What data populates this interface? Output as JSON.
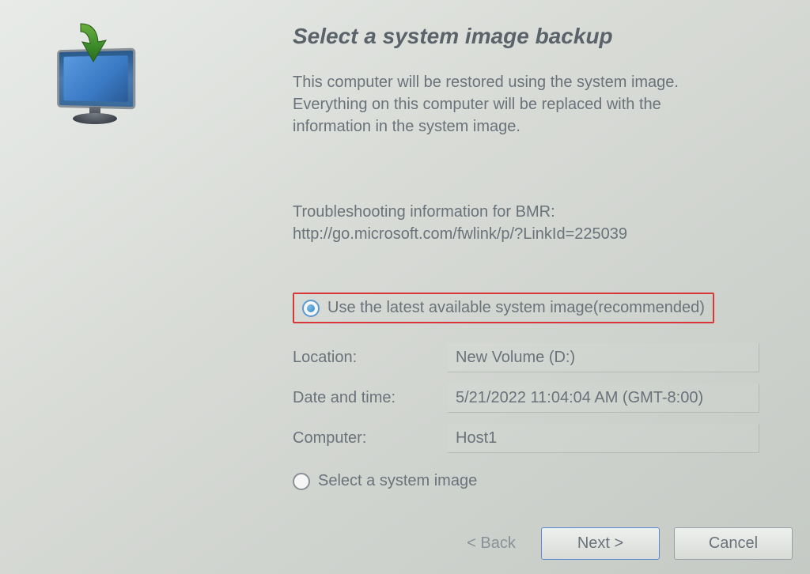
{
  "header": {
    "title": "Select a system image backup",
    "description": "This computer will be restored using the system image. Everything on this computer will be replaced with the information in the system image."
  },
  "troubleshoot": {
    "line1": "Troubleshooting information for BMR:",
    "line2": "http://go.microsoft.com/fwlink/p/?LinkId=225039"
  },
  "options": {
    "use_latest": {
      "label": "Use the latest available system image(recommended)",
      "selected": true
    },
    "select_image": {
      "label": "Select a system image",
      "selected": false
    }
  },
  "details": {
    "location": {
      "label": "Location:",
      "value": "New Volume (D:)"
    },
    "datetime": {
      "label": "Date and time:",
      "value": "5/21/2022 11:04:04 AM (GMT-8:00)"
    },
    "computer": {
      "label": "Computer:",
      "value": "Host1"
    }
  },
  "buttons": {
    "back": "< Back",
    "next": "Next >",
    "cancel": "Cancel"
  }
}
